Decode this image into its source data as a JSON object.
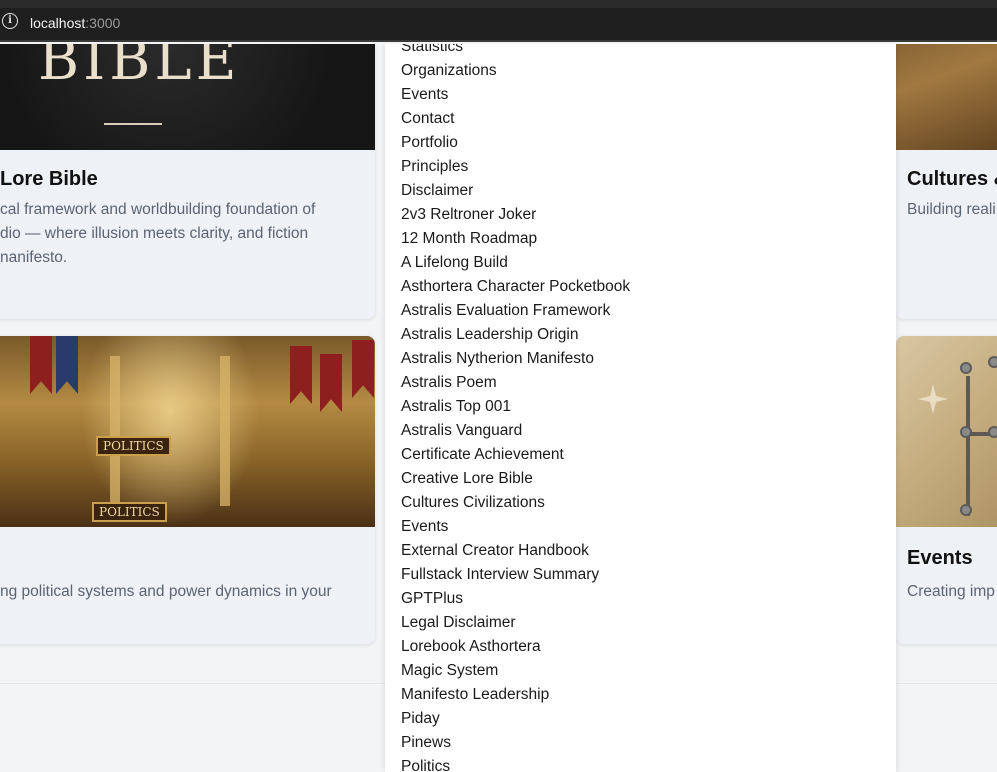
{
  "browser": {
    "url_host": "localhost",
    "url_port": ":3000",
    "info_icon": "info-icon"
  },
  "cards": {
    "lore": {
      "image_text": "BIBLE",
      "title": "Lore Bible",
      "desc_lines": [
        "cal framework and worldbuilding foundation of",
        "dio — where illusion meets clarity, and fiction",
        "nanifesto."
      ]
    },
    "politics": {
      "plaque_top": "POLITICS",
      "plaque_bottom": "POLITICS",
      "desc_lines": [
        "ng political systems and power dynamics in your"
      ]
    },
    "cultures": {
      "title": "Cultures &",
      "desc_lines": [
        "Building reali"
      ]
    },
    "events": {
      "title": "Events",
      "desc_lines": [
        "Creating imp"
      ]
    }
  },
  "menu": {
    "items": [
      "Statistics",
      "Organizations",
      "Events",
      "Contact",
      "Portfolio",
      "Principles",
      "Disclaimer",
      "2v3 Reltroner Joker",
      "12 Month Roadmap",
      "A Lifelong Build",
      "Asthortera Character Pocketbook",
      "Astralis Evaluation Framework",
      "Astralis Leadership Origin",
      "Astralis Nytherion Manifesto",
      "Astralis Poem",
      "Astralis Top 001",
      "Astralis Vanguard",
      "Certificate Achievement",
      "Creative Lore Bible",
      "Cultures Civilizations",
      "Events",
      "External Creator Handbook",
      "Fullstack Interview Summary",
      "GPTPlus",
      "Legal Disclaimer",
      "Lorebook Asthortera",
      "Magic System",
      "Manifesto Leadership",
      "Piday",
      "Pinews",
      "Politics"
    ]
  }
}
